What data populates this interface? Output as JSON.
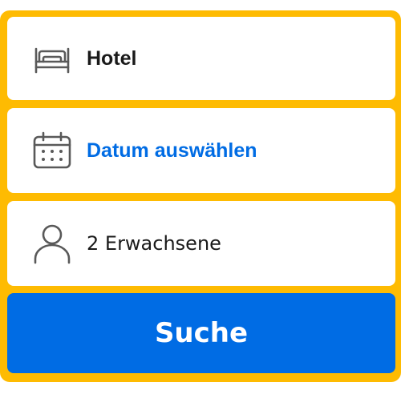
{
  "destination": {
    "value": "Hotel",
    "icon": "bed-icon"
  },
  "dates": {
    "placeholder": "Datum auswählen",
    "icon": "calendar-icon"
  },
  "guests": {
    "value": "2 Erwachsene",
    "icon": "person-icon"
  },
  "search": {
    "label": "Suche"
  },
  "colors": {
    "panel_border": "#febb02",
    "primary": "#006ce4",
    "text": "#1a1a1a",
    "icon": "#595959"
  }
}
